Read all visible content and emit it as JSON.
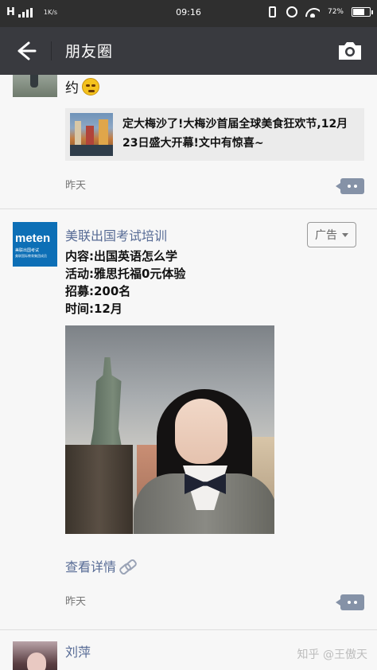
{
  "status_bar": {
    "network": "H",
    "speed": "1K/s",
    "time": "09:16",
    "battery_percent": "72%",
    "battery_level": 0.72,
    "icons": [
      "signal-icon",
      "vibrate-icon",
      "alarm-icon",
      "wifi-icon",
      "battery-icon"
    ]
  },
  "header": {
    "title": "朋友圈",
    "back_icon": "arrow-left-icon",
    "camera_icon": "camera-icon"
  },
  "posts": [
    {
      "text": "约",
      "emoji": "embarrassed-emoji",
      "link_card": {
        "title": "定大梅沙了!大梅沙首届全球美食狂欢节,12月23日盛大开幕!文中有惊喜~"
      },
      "time": "昨天"
    },
    {
      "author": "美联出国考试培训",
      "avatar_text": "meten",
      "avatar_subtext": "美联出国考试",
      "avatar_subtext2": "美联国际教育集团成员",
      "ad_label": "广告",
      "lines": [
        "内容:出国英语怎么学",
        "活动:雅思托福0元体验",
        "招募:200名",
        "时间:12月"
      ],
      "details_label": "查看详情",
      "time": "昨天"
    },
    {
      "author": "刘萍",
      "text": "...."
    }
  ],
  "watermark": "知乎 @王傲天",
  "colors": {
    "header_bg": "#393a3f",
    "status_bg": "#2f2f2f",
    "link_blue": "#576b95",
    "feed_bg": "#f7f7f7"
  }
}
